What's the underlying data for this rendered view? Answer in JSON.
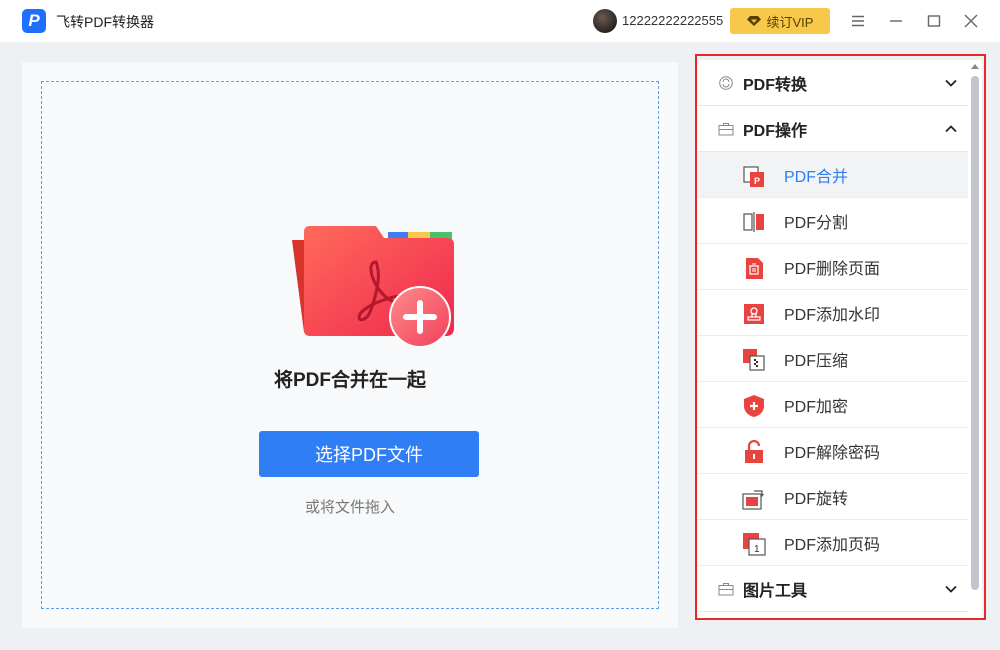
{
  "app": {
    "title": "飞转PDF转换器",
    "logo_letter": "P"
  },
  "user": {
    "name": "12222222222555"
  },
  "vip": {
    "label": "续订VIP"
  },
  "main": {
    "title": "将PDF合并在一起",
    "select_button": "选择PDF文件",
    "drag_hint": "或将文件拖入"
  },
  "sidebar": {
    "categories": [
      {
        "label": "PDF转换",
        "expanded": false
      },
      {
        "label": "PDF操作",
        "expanded": true
      },
      {
        "label": "图片工具",
        "expanded": false
      }
    ],
    "items": [
      {
        "label": "PDF合并",
        "active": true
      },
      {
        "label": "PDF分割",
        "active": false
      },
      {
        "label": "PDF删除页面",
        "active": false
      },
      {
        "label": "PDF添加水印",
        "active": false
      },
      {
        "label": "PDF压缩",
        "active": false
      },
      {
        "label": "PDF加密",
        "active": false
      },
      {
        "label": "PDF解除密码",
        "active": false
      },
      {
        "label": "PDF旋转",
        "active": false
      },
      {
        "label": "PDF添加页码",
        "active": false
      }
    ]
  },
  "colors": {
    "accent": "#2f7ef5",
    "vip": "#f7c84a",
    "icon_red": "#e8433f",
    "highlight": "#e22a2a"
  }
}
